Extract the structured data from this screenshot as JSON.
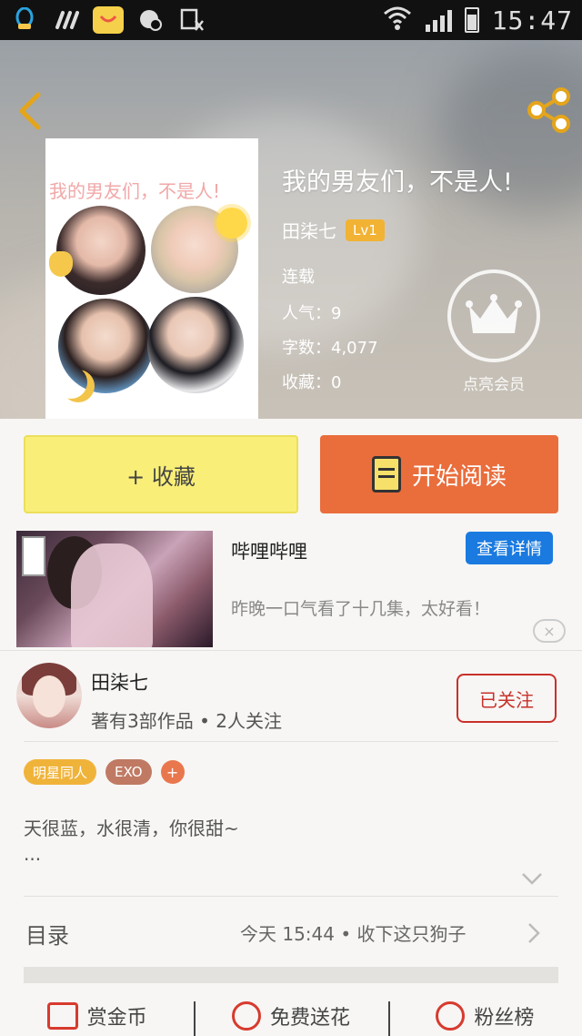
{
  "status_bar": {
    "time": "15:47",
    "icons": [
      "qq-icon",
      "swipe-icon",
      "app-store-icon",
      "message-icon",
      "cashier-icon",
      "wifi-icon",
      "signal-icon",
      "battery-icon"
    ]
  },
  "header": {
    "back_icon": "chevron-left-icon",
    "share_icon": "share-icon",
    "cover_title": "我的男友们，不是人!",
    "book_title": "我的男友们，不是人!",
    "author": "田柒七",
    "level": "Lv1",
    "status": "连载",
    "popularity": "人气：9",
    "word_count": "字数：4,077",
    "favorites": "收藏：0",
    "vip_label": "点亮会员"
  },
  "actions": {
    "collect_label": "+ 收藏",
    "read_label": "开始阅读"
  },
  "ad": {
    "name": "哔哩哔哩",
    "detail_button": "查看详情",
    "description": "昨晚一口气看了十几集，太好看！",
    "close_label": "×"
  },
  "author_card": {
    "name": "田柒七",
    "stats": "著有3部作品 • 2人关注",
    "follow_button": "已关注"
  },
  "tags": [
    {
      "label": "明星同人",
      "color": "#f0b33a"
    },
    {
      "label": "EXO",
      "color": "#c07a63"
    }
  ],
  "tag_add": "+",
  "intro": {
    "text": "天很蓝，水很清，你很甜~",
    "more": "..."
  },
  "toc": {
    "label": "目录",
    "latest": "今天  15:44  •  收下这只狗子"
  },
  "bottom_actions": [
    {
      "label": "赏金币",
      "icon": "envelope-icon"
    },
    {
      "label": "免费送花",
      "icon": "flower-icon"
    },
    {
      "label": "粉丝榜",
      "icon": "target-icon"
    }
  ],
  "colors": {
    "accent_orange": "#ea6d3c",
    "accent_yellow": "#f9ef78",
    "level_badge": "#f2b233",
    "follow_red": "#c9312b",
    "detail_blue": "#1a7ae0"
  }
}
